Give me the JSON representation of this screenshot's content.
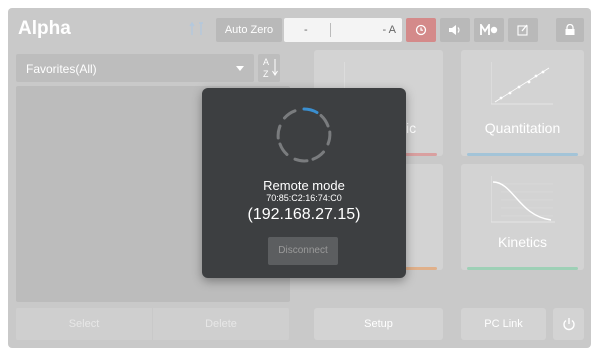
{
  "header": {
    "title": "Alpha",
    "auto_zero_label": "Auto Zero",
    "reading_left": "-",
    "reading_right": "- A"
  },
  "icons": {
    "usb": "usb-icon",
    "clock": "clock-icon",
    "sound": "speaker-icon",
    "mode": "mode-icon",
    "edit": "edit-icon",
    "lock": "lock-icon",
    "power": "power-icon"
  },
  "left_panel": {
    "favorites_label": "Favorites(All)",
    "sort_label_top": "A",
    "sort_label_bottom": "Z",
    "select_label": "Select",
    "delete_label": "Delete"
  },
  "tiles": {
    "a_label": "ic",
    "quantitation_label": "Quantitation",
    "kinetics_label": "Kinetics",
    "c_label": ""
  },
  "footer": {
    "setup_label": "Setup",
    "pclink_label": "PC Link"
  },
  "modal": {
    "title": "Remote mode",
    "mac": "70:85:C2:16:74:C0",
    "ip": "(192.168.27.15)",
    "disconnect_label": "Disconnect"
  },
  "colors": {
    "clock_button": "#d48a8a",
    "tile_a_bar": "#d9a0a0",
    "tile_quant_bar": "#a3c4d8",
    "tile_c_bar": "#e0b08a",
    "tile_kin_bar": "#9ed0b6",
    "spinner_accent": "#3a8fd0"
  }
}
